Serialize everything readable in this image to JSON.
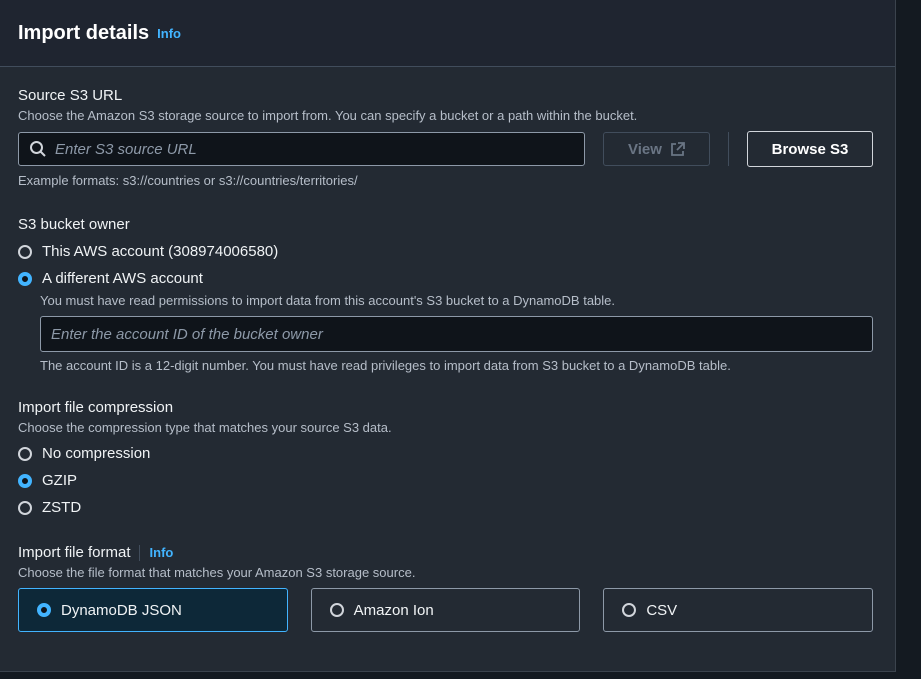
{
  "header": {
    "title": "Import details",
    "info": "Info"
  },
  "source": {
    "label": "Source S3 URL",
    "description": "Choose the Amazon S3 storage source to import from. You can specify a bucket or a path within the bucket.",
    "placeholder": "Enter S3 source URL",
    "view_label": "View",
    "browse_label": "Browse S3",
    "example": "Example formats: s3://countries or s3://countries/territories/"
  },
  "owner": {
    "label": "S3 bucket owner",
    "options": [
      {
        "label": "This AWS account (308974006580)",
        "checked": false
      },
      {
        "label": "A different AWS account",
        "checked": true
      }
    ],
    "different_desc": "You must have read permissions to import data from this account's S3 bucket to a DynamoDB table.",
    "account_placeholder": "Enter the account ID of the bucket owner",
    "account_hint": "The account ID is a 12-digit number. You must have read privileges to import data from S3 bucket to a DynamoDB table."
  },
  "compression": {
    "label": "Import file compression",
    "description": "Choose the compression type that matches your source S3 data.",
    "options": [
      {
        "label": "No compression",
        "checked": false
      },
      {
        "label": "GZIP",
        "checked": true
      },
      {
        "label": "ZSTD",
        "checked": false
      }
    ]
  },
  "format": {
    "label": "Import file format",
    "info": "Info",
    "description": "Choose the file format that matches your Amazon S3 storage source.",
    "options": [
      {
        "label": "DynamoDB JSON",
        "checked": true
      },
      {
        "label": "Amazon Ion",
        "checked": false
      },
      {
        "label": "CSV",
        "checked": false
      }
    ]
  },
  "colors": {
    "accent": "#42b4ff",
    "background": "#232a33"
  },
  "icons": {
    "search": "search-icon",
    "external": "external-link-icon"
  }
}
